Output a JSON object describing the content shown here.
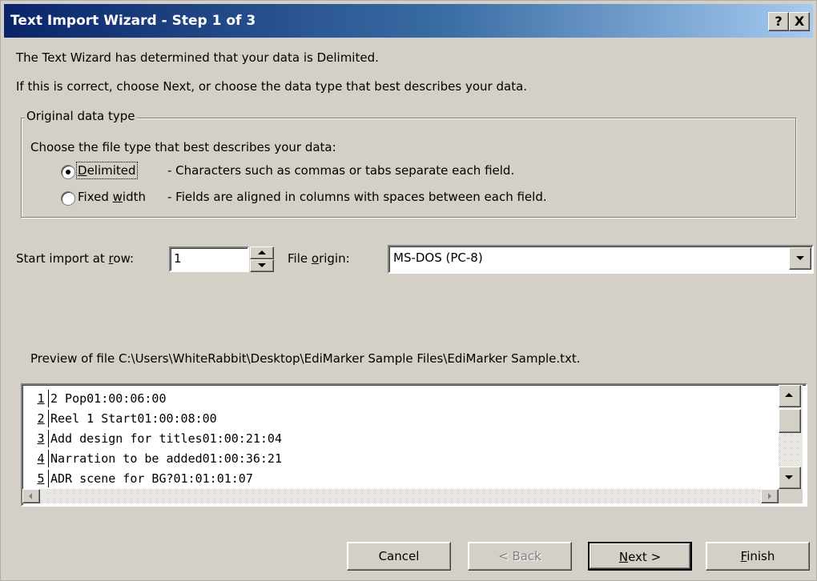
{
  "window": {
    "title": "Text Import Wizard - Step 1 of 3",
    "help_label": "?",
    "close_label": "X"
  },
  "intro": {
    "line1": "The Text Wizard has determined that your data is Delimited.",
    "line2": "If this is correct, choose Next, or choose the data type that best describes your data."
  },
  "original_data_type": {
    "legend": "Original data type",
    "prompt": "Choose the file type that best describes your data:",
    "options": [
      {
        "label_pre": "",
        "label_ul": "D",
        "label_post": "elimited",
        "description": "- Characters such as commas or tabs separate each field.",
        "selected": true
      },
      {
        "label_pre": "Fixed ",
        "label_ul": "w",
        "label_post": "idth",
        "description": "- Fields are aligned in columns with spaces between each field.",
        "selected": false
      }
    ]
  },
  "start_row": {
    "label_pre": "Start import at ",
    "label_ul": "r",
    "label_post": "ow:",
    "value": "1"
  },
  "file_origin": {
    "label_pre": "File ",
    "label_ul": "o",
    "label_post": "rigin:",
    "value": "MS-DOS (PC-8)"
  },
  "preview": {
    "label": "Preview of file C:\\Users\\WhiteRabbit\\Desktop\\EdiMarker Sample Files\\EdiMarker Sample.txt.",
    "rows": [
      {
        "num": "1",
        "text": "2 Pop01:00:06:00"
      },
      {
        "num": "2",
        "text": "Reel 1 Start01:00:08:00"
      },
      {
        "num": "3",
        "text": "Add design for titles01:00:21:04"
      },
      {
        "num": "4",
        "text": "Narration to be added01:00:36:21"
      },
      {
        "num": "5",
        "text": "ADR scene for BG?01:01:01:07"
      }
    ]
  },
  "buttons": {
    "cancel": "Cancel",
    "back": "< Back",
    "next_ul": "N",
    "next_post": "ext >",
    "finish_ul": "F",
    "finish_post": "inish"
  }
}
